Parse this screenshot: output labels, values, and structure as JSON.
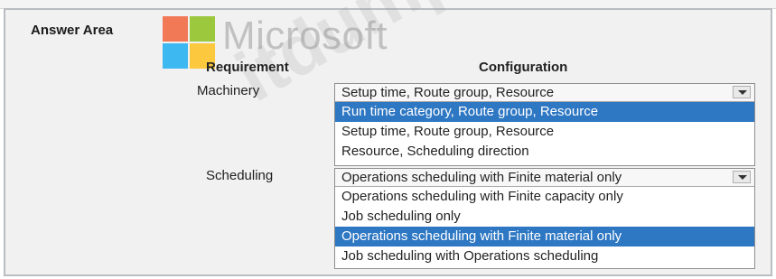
{
  "watermark": {
    "logo_text": "Microsoft",
    "site_text": "itdumps.com"
  },
  "colors": {
    "logo_red": "#f25022",
    "logo_green": "#7fba00",
    "logo_blue": "#00a4ef",
    "logo_yellow": "#ffb900",
    "selection": "#2e77c3"
  },
  "answer_area": {
    "title": "Answer Area",
    "headers": {
      "requirement": "Requirement",
      "configuration": "Configuration"
    },
    "rows": [
      {
        "label": "Machinery",
        "selected": "Setup time, Route group, Resource",
        "options": [
          {
            "text": "Run time category, Route group, Resource",
            "highlighted": true
          },
          {
            "text": "Setup time, Route group, Resource",
            "highlighted": false
          },
          {
            "text": "Resource, Scheduling direction",
            "highlighted": false
          }
        ]
      },
      {
        "label": "Scheduling",
        "selected": "Operations scheduling with Finite material only",
        "options": [
          {
            "text": "Operations scheduling with Finite capacity only",
            "highlighted": false
          },
          {
            "text": "Job scheduling only",
            "highlighted": false
          },
          {
            "text": "Operations scheduling with Finite material only",
            "highlighted": true
          },
          {
            "text": "Job scheduling with Operations scheduling",
            "highlighted": false
          }
        ]
      }
    ]
  }
}
